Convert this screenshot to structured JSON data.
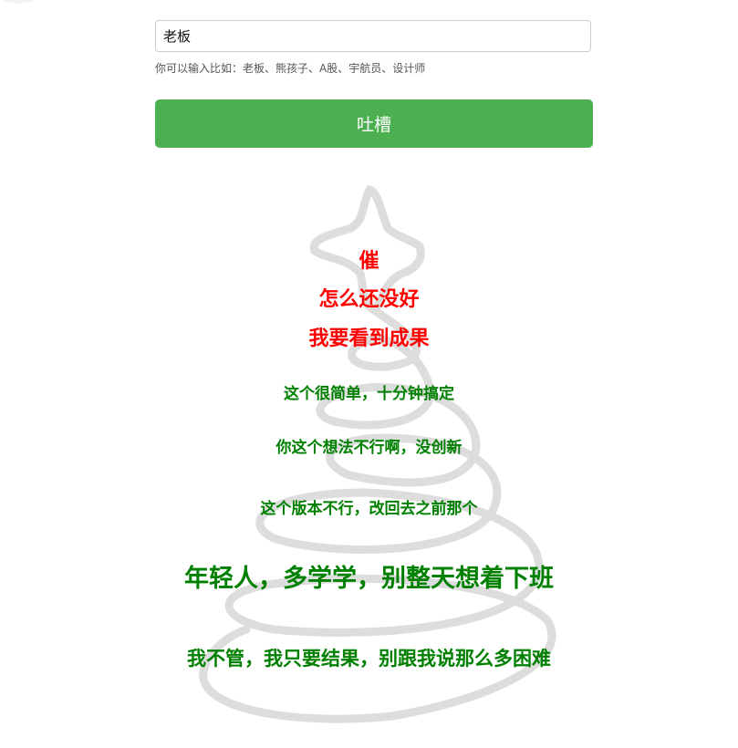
{
  "input": {
    "value": "老板"
  },
  "hint": "你可以输入比如：老板、熊孩子、A股、宇航员、设计师",
  "submit_label": "吐槽",
  "colors": {
    "accent": "#4caf50",
    "red_text": "#ff0000",
    "green_text": "#008000",
    "tree": "#dddddd"
  },
  "tree_lines": [
    {
      "text": "催",
      "color": "red"
    },
    {
      "text": "怎么还没好",
      "color": "red"
    },
    {
      "text": "我要看到成果",
      "color": "red"
    },
    {
      "text": "这个很简单，十分钟搞定",
      "color": "green"
    },
    {
      "text": "你这个想法不行啊，没创新",
      "color": "green"
    },
    {
      "text": "这个版本不行，改回去之前那个",
      "color": "green"
    },
    {
      "text": "年轻人，多学学，别整天想着下班",
      "color": "green"
    },
    {
      "text": "我不管，我只要结果，别跟我说那么多困难",
      "color": "green"
    }
  ]
}
